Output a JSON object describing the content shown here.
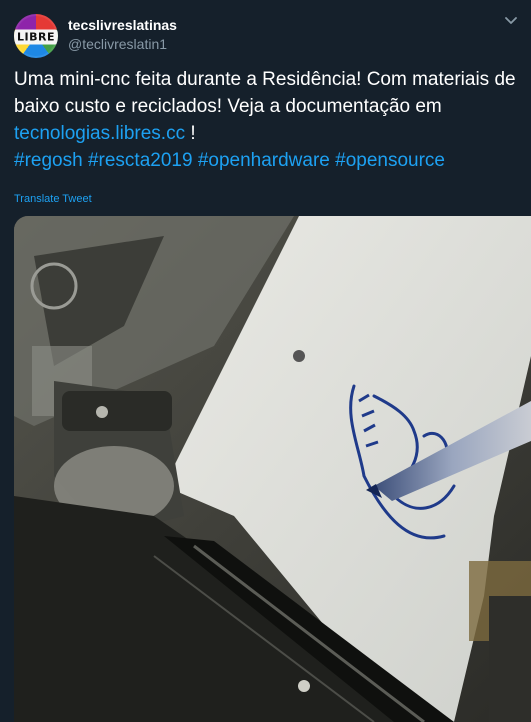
{
  "tweet": {
    "author_name": "tecslivreslatinas",
    "author_handle": "@teclivreslatin1",
    "avatar_logo_text": "LIBRE",
    "text_part1": "Uma mini-cnc feita durante a Residência! Com materiais de baixo custo e reciclados! Veja a documentação em ",
    "link": "tecnologias.libres.cc",
    "text_part2": " ! ",
    "hashtags": [
      "#regosh",
      "#rescta2019",
      "#openhardware",
      "#opensource"
    ],
    "translate_label": "Translate Tweet",
    "media": {
      "description_icon": "video-thumbnail"
    }
  },
  "icons": {
    "more": "chevron-down-icon"
  },
  "colors": {
    "background": "#15202b",
    "link": "#1da1f2",
    "secondary_text": "#8899a6"
  }
}
